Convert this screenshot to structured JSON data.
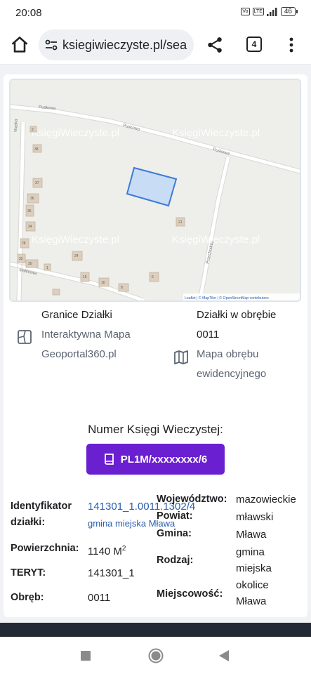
{
  "status": {
    "time": "20:08",
    "network": "LTE",
    "battery": "46"
  },
  "browser": {
    "url": "ksiegiwieczyste.pl/sea",
    "tab_count": "4"
  },
  "map": {
    "street_labels": [
      "Puskowa",
      "Puskowa",
      "Puskowa",
      "Wąska",
      "Malinowa",
      "Przechodnia"
    ],
    "watermark": "KsięgiWieczyste.pl",
    "house_numbers": [
      "2",
      "5",
      "38",
      "37",
      "36",
      "35",
      "34",
      "28",
      "32",
      "30",
      "24",
      "15",
      "10",
      "8",
      "6",
      "4",
      "1",
      "21"
    ],
    "attribution": "Leaflet | © MapTiler | © OpenStreetMap contributors"
  },
  "boundaries": {
    "title": "Granice Działki",
    "line1": "Interaktywna Mapa",
    "line2": "Geoportal360.pl"
  },
  "district": {
    "title": "Działki w obrębie",
    "code": "0011",
    "line1": "Mapa obrębu",
    "line2": "ewidencyjnego"
  },
  "kw": {
    "label": "Numer Księgi Wieczystej:",
    "button": "PL1M/xxxxxxxx/6"
  },
  "details_left": {
    "id_label_1": "Identyfikator",
    "id_label_2": "działki:",
    "id_value": "141301_1.0011.1302/4",
    "gmina_link": "gmina miejska Mława",
    "area_label": "Powierzchnia:",
    "area_value": "1140 M",
    "area_sup": "2",
    "teryt_label": "TERYT:",
    "teryt_value": "141301_1",
    "obreb_label": "Obręb:",
    "obreb_value": "0011"
  },
  "details_right": {
    "woj_label": "Województwo:",
    "woj_value": "mazowieckie",
    "powiat_label": "Powiat:",
    "powiat_value": "mławski",
    "gmina_label": "Gmina:",
    "gmina_value": "Mława",
    "rodzaj_label": "Rodzaj:",
    "rodzaj_value_1": "gmina",
    "rodzaj_value_2": "miejska",
    "miejsc_label": "Miejscowość:",
    "miejsc_value_1": "okolice",
    "miejsc_value_2": "Mława"
  },
  "colors": {
    "accent": "#6a1fd0",
    "link": "#2a5db0",
    "parcel_fill": "#c9dcf6",
    "parcel_stroke": "#3a7bd5"
  }
}
